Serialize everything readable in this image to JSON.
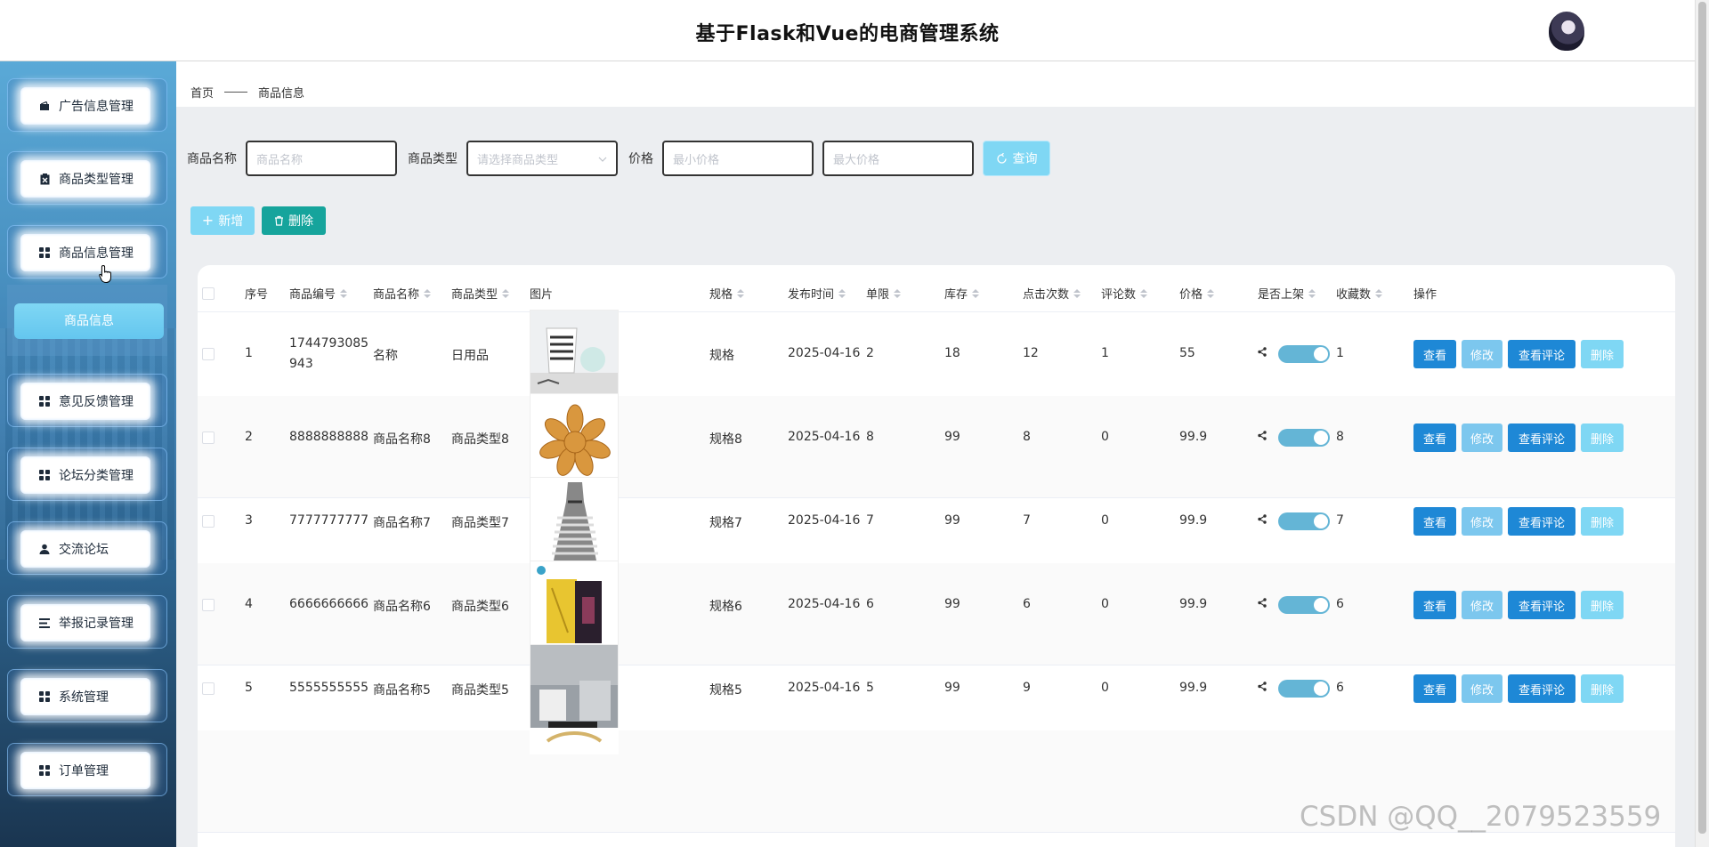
{
  "header": {
    "title": "基于Flask和Vue的电商管理系统"
  },
  "sidebar": {
    "items": [
      {
        "label": "广告信息管理",
        "icon": "wallet-icon"
      },
      {
        "label": "商品类型管理",
        "icon": "clipboard-icon"
      },
      {
        "label": "商品信息管理",
        "icon": "grid-icon"
      },
      {
        "label": "意见反馈管理",
        "icon": "grid-icon"
      },
      {
        "label": "论坛分类管理",
        "icon": "grid-icon"
      },
      {
        "label": "交流论坛",
        "icon": "user-icon"
      },
      {
        "label": "举报记录管理",
        "icon": "list-icon"
      },
      {
        "label": "系统管理",
        "icon": "grid-icon"
      },
      {
        "label": "订单管理",
        "icon": "grid-icon"
      }
    ],
    "submenu": {
      "label": "商品信息"
    }
  },
  "breadcrumb": {
    "home": "首页",
    "current": "商品信息"
  },
  "filters": {
    "name_label": "商品名称",
    "name_placeholder": "商品名称",
    "type_label": "商品类型",
    "type_placeholder": "请选择商品类型",
    "price_label": "价格",
    "min_placeholder": "最小价格",
    "max_placeholder": "最大价格",
    "search_label": "查询"
  },
  "toolbar": {
    "add_label": "新增",
    "delete_label": "删除"
  },
  "table": {
    "headers": {
      "index": "序号",
      "code": "商品编号",
      "name": "商品名称",
      "type": "商品类型",
      "image": "图片",
      "spec": "规格",
      "date": "发布时间",
      "limit": "单限",
      "stock": "库存",
      "clicks": "点击次数",
      "comments": "评论数",
      "price": "价格",
      "onsale": "是否上架",
      "favorites": "收藏数",
      "actions": "操作"
    },
    "action_labels": {
      "view": "查看",
      "edit": "修改",
      "comments": "查看评论",
      "delete": "删除"
    },
    "rows": [
      {
        "index": "1",
        "code": "1744793085943",
        "name": "名称",
        "type": "日用品",
        "spec": "规格",
        "date": "2025-04-16",
        "limit": "2",
        "stock": "18",
        "clicks": "12",
        "comments": "1",
        "price": "55",
        "favorites": "1",
        "image": "cup"
      },
      {
        "index": "2",
        "code": "8888888888",
        "name": "商品名称8",
        "type": "商品类型8",
        "spec": "规格8",
        "date": "2025-04-16",
        "limit": "8",
        "stock": "99",
        "clicks": "8",
        "comments": "0",
        "price": "99.9",
        "favorites": "8",
        "image": "dates"
      },
      {
        "index": "3",
        "code": "7777777777",
        "name": "商品名称7",
        "type": "商品类型7",
        "spec": "规格7",
        "date": "2025-04-16",
        "limit": "7",
        "stock": "99",
        "clicks": "7",
        "comments": "0",
        "price": "99.9",
        "favorites": "7",
        "image": "dress"
      },
      {
        "index": "4",
        "code": "6666666666",
        "name": "商品名称6",
        "type": "商品类型6",
        "spec": "规格6",
        "date": "2025-04-16",
        "limit": "6",
        "stock": "99",
        "clicks": "6",
        "comments": "0",
        "price": "99.9",
        "favorites": "6",
        "image": "wine"
      },
      {
        "index": "5",
        "code": "5555555555",
        "name": "商品名称5",
        "type": "商品类型5",
        "spec": "规格5",
        "date": "2025-04-16",
        "limit": "5",
        "stock": "99",
        "clicks": "9",
        "comments": "0",
        "price": "99.9",
        "favorites": "6",
        "image": "bag"
      }
    ]
  },
  "watermark": "CSDN @QQ__2079523559",
  "colors": {
    "accent": "#7fd7f4",
    "primary": "#1e88d6",
    "teal": "#16a49c",
    "switch_on": "#64b5d6"
  }
}
